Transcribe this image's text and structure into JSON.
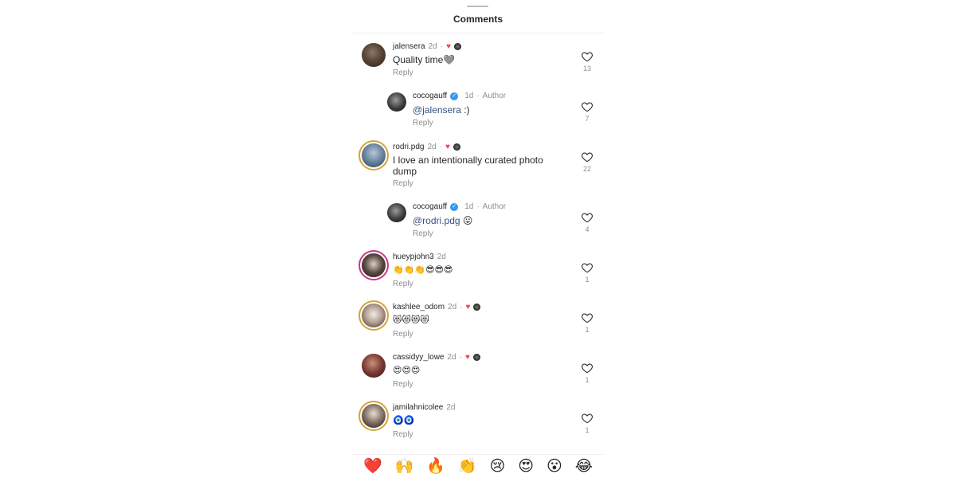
{
  "header": {
    "title": "Comments"
  },
  "comments": [
    {
      "username": "jalensera",
      "time": "2d",
      "liked_by_author": true,
      "text": "Quality time🩶",
      "reply": "Reply",
      "likes": "13"
    },
    {
      "username": "cocogauff",
      "verified": true,
      "time": "1d",
      "author": "Author",
      "mention": "@jalensera",
      "text": " :)",
      "reply": "Reply",
      "likes": "7"
    },
    {
      "username": "rodri.pdg",
      "time": "2d",
      "liked_by_author": true,
      "text": "I love an intentionally curated photo dump",
      "reply": "Reply",
      "likes": "22"
    },
    {
      "username": "cocogauff",
      "verified": true,
      "time": "1d",
      "author": "Author",
      "mention": "@rodri.pdg",
      "text": " 😛",
      "reply": "Reply",
      "likes": "4"
    },
    {
      "username": "hueypjohn3",
      "time": "2d",
      "text": "👏👏👏😎😎😎",
      "reply": "Reply",
      "likes": "1"
    },
    {
      "username": "kashlee_odom",
      "time": "2d",
      "liked_by_author": true,
      "text": "😻😻😻😻",
      "reply": "Reply",
      "likes": "1"
    },
    {
      "username": "cassidyy_lowe",
      "time": "2d",
      "liked_by_author": true,
      "text": "😍😍😍",
      "reply": "Reply",
      "likes": "1"
    },
    {
      "username": "jamilahnicolee",
      "time": "2d",
      "text": "🧿🧿",
      "reply": "Reply",
      "likes": "1"
    }
  ],
  "separator": "·",
  "icons": {
    "like": "heart-outline-icon",
    "liked_by_author": "red-heart-icon",
    "verified": "verified-badge-icon"
  },
  "colors": {
    "mention": "#385185",
    "secondary_text": "#8e8e8e",
    "verified": "#3897f0",
    "liked_heart": "#ed4956"
  },
  "emoji_bar": [
    "❤️",
    "🙌",
    "🔥",
    "👏",
    "😢",
    "😍",
    "😮",
    "😂"
  ]
}
